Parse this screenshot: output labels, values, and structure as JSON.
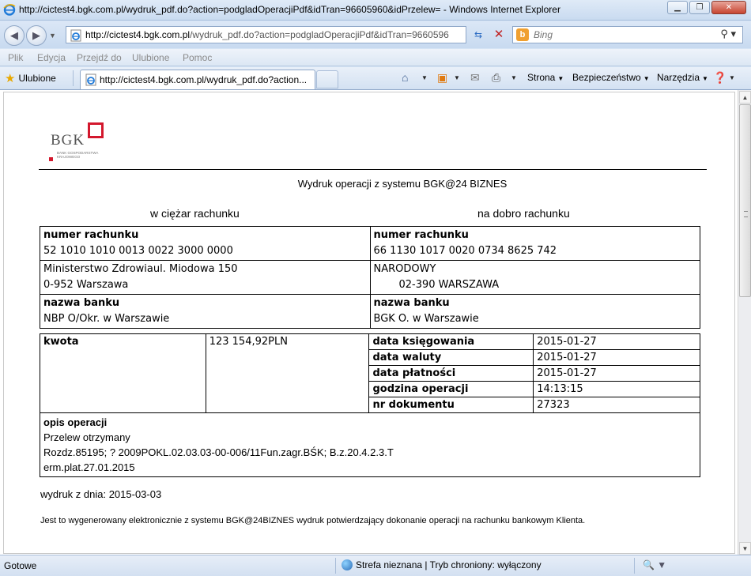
{
  "window": {
    "title": "http://cictest4.bgk.com.pl/wydruk_pdf.do?action=podgladOperacjiPdf&idTran=96605960&idPrzelew= - Windows Internet Explorer"
  },
  "address_bar": {
    "url_host": "http://cictest4.bgk.com.pl",
    "url_path": "/wydruk_pdf.do?action=podgladOperacjiPdf&idTran=9660596"
  },
  "search": {
    "placeholder": "Bing"
  },
  "menu": {
    "plik": "Plik",
    "edycja": "Edycja",
    "przejdz": "Przejdź do",
    "ulubione": "Ulubione",
    "pomoc": "Pomoc"
  },
  "favorites_bar": {
    "favorites_label": "Ulubione",
    "tab_title": "http://cictest4.bgk.com.pl/wydruk_pdf.do?action...",
    "strona": "Strona",
    "bezpieczenstwo": "Bezpieczeństwo",
    "narzedzia": "Narzędzia"
  },
  "document": {
    "logo_text": "BGK",
    "logo_subtitle": "BANK GOSPODARSTWA KRAJOWEGO",
    "title": "Wydruk operacji z systemu BGK@24 BIZNES",
    "debit_header": "w ciężar rachunku",
    "credit_header": "na dobro rachunku",
    "debit": {
      "account_label": "numer rachunku",
      "account_number": "52 1010 1010 0013 0022 3000 0000",
      "name_line1": "Ministerstwo Zdrowiaul. Miodowa 150",
      "name_line2": "0-952 Warszawa",
      "bank_label": "nazwa banku",
      "bank_name": "NBP O/Okr. w Warszawie"
    },
    "credit": {
      "account_label": "numer rachunku",
      "account_number": "66 1130 1017 0020 0734 8625 742",
      "name_line1": "NARODOWY",
      "name_line2": "02-390 WARSZAWA",
      "bank_label": "nazwa banku",
      "bank_name": "BGK O. w Warszawie"
    },
    "details": {
      "amount_label": "kwota",
      "amount_value": "123 154,92PLN",
      "booking_date_label": "data księgowania",
      "booking_date": "2015-01-27",
      "value_date_label": "data waluty",
      "value_date": "2015-01-27",
      "payment_date_label": "data płatności",
      "payment_date": "2015-01-27",
      "time_label": "godzina operacji",
      "time": "14:13:15",
      "doc_no_label": "nr dokumentu",
      "doc_no": "27323",
      "description_label": "opis operacji",
      "description_line1": "Przelew otrzymany",
      "description_line2": "Rozdz.85195; ? 2009POKL.02.03.03-00-006/11Fun.zagr.BŚK; B.z.20.4.2.3.T",
      "description_line3": "erm.plat.27.01.2015"
    },
    "print_date": "wydruk z dnia: 2015-03-03",
    "footnote": "Jest to wygenerowany elektronicznie z systemu BGK@24BIZNES wydruk potwierdzający dokonanie operacji na rachunku bankowym Klienta."
  },
  "status_bar": {
    "status": "Gotowe",
    "zone": "Strefa nieznana | Tryb chroniony: wyłączony"
  }
}
